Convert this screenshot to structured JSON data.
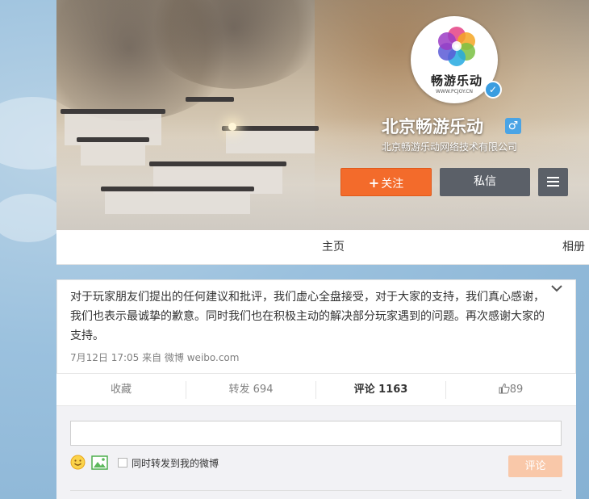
{
  "profile": {
    "avatar_brand": "畅游乐动",
    "avatar_sub": "WWW.PCJOY.CN",
    "name": "北京畅游乐动",
    "gender_symbol": "♂",
    "verified_symbol": "✓",
    "company": "北京畅游乐动网络技术有限公司",
    "follow_plus": "+",
    "follow_label": "关注",
    "message_label": "私信"
  },
  "nav": {
    "home": "主页",
    "album": "相册"
  },
  "post": {
    "text": "对于玩家朋友们提出的任何建议和批评，我们虚心全盘接受，对于大家的支持，我们真心感谢，我们也表示最诚挚的歉意。同时我们也在积极主动的解决部分玩家遇到的问题。再次感谢大家的支持。",
    "meta": "7月12日 17:05 来自 微博 weibo.com",
    "actions": {
      "favorite": "收藏",
      "repost": "转发 694",
      "comment": "评论 1163",
      "like": "89"
    }
  },
  "comment_box": {
    "repost_option": "同时转发到我的微博",
    "submit_label": "评论"
  },
  "colors": {
    "follow": "#f36b2b",
    "message": "#5b6068",
    "comment_button": "#f9c8a9",
    "verified": "#3a9de0"
  }
}
